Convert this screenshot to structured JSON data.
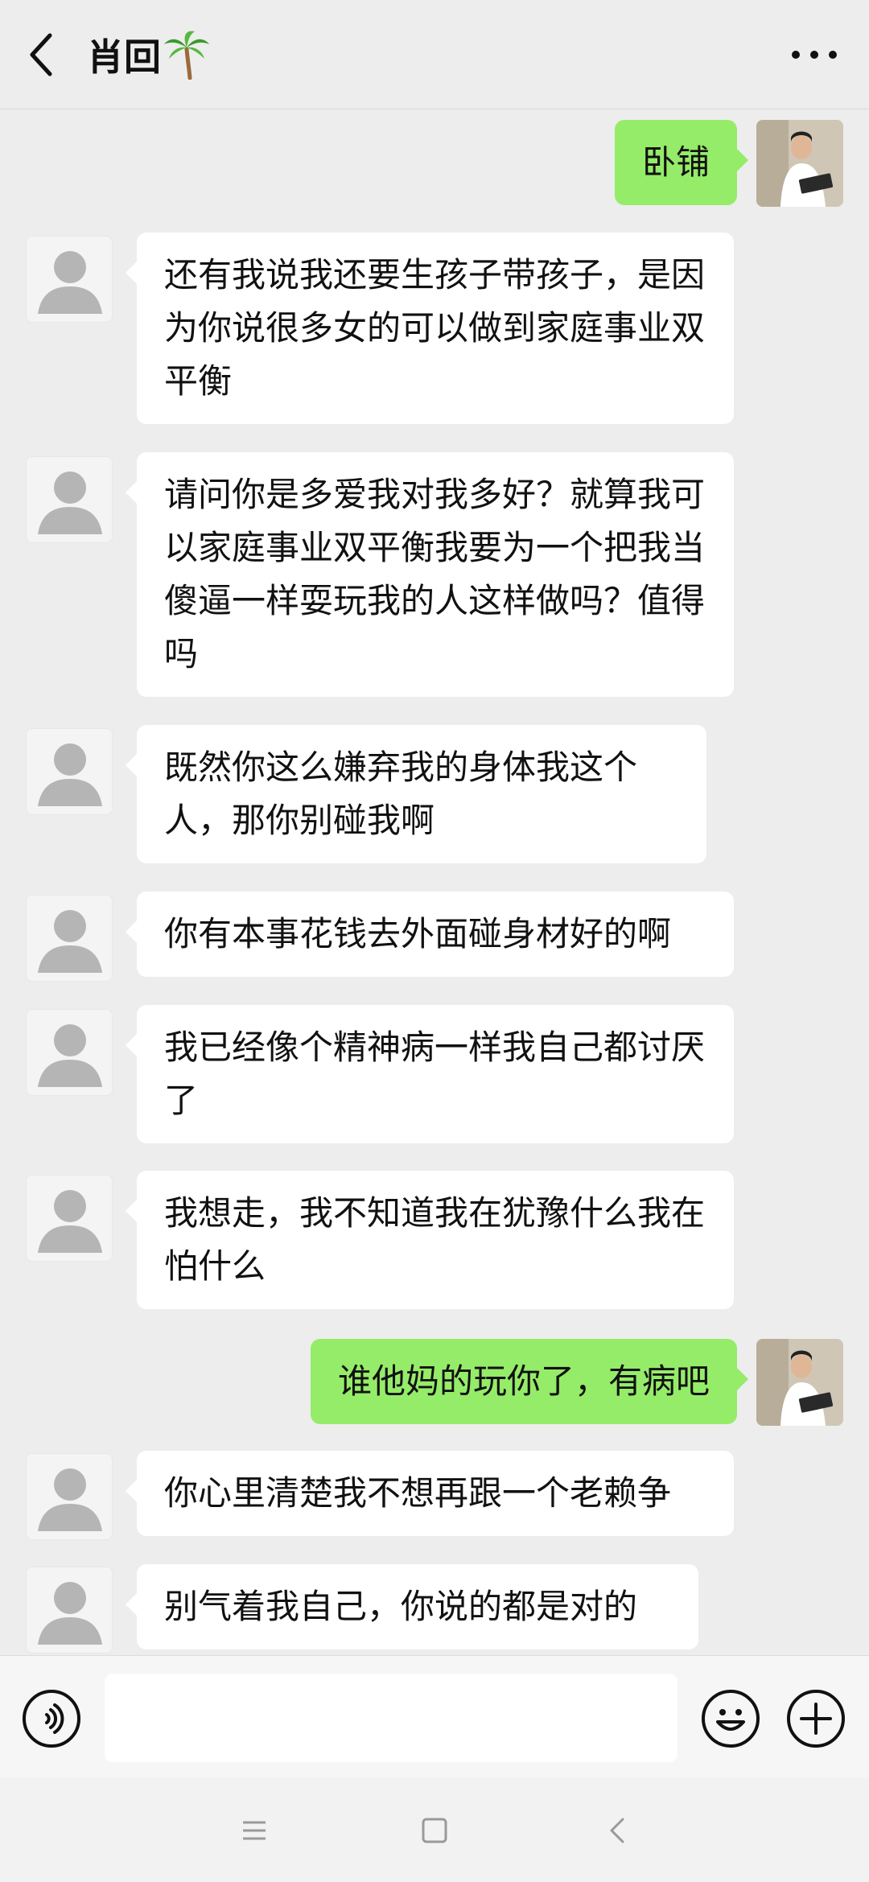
{
  "header": {
    "back_icon": "chevron-left-icon",
    "contact_name": "肖回",
    "name_emoji_icon": "palm-tree-icon",
    "more_icon": "more-dots-icon"
  },
  "messages": [
    {
      "side": "right",
      "text": "卧铺"
    },
    {
      "side": "left",
      "text": "还有我说我还要生孩子带孩子，是因为你说很多女的可以做到家庭事业双平衡"
    },
    {
      "side": "left",
      "text": "请问你是多爱我对我多好？就算我可以家庭事业双平衡我要为一个把我当傻逼一样耍玩我的人这样做吗？值得吗"
    },
    {
      "side": "left",
      "text": "既然你这么嫌弃我的身体我这个人，那你别碰我啊"
    },
    {
      "side": "left",
      "text": "你有本事花钱去外面碰身材好的啊"
    },
    {
      "side": "left",
      "text": "我已经像个精神病一样我自己都讨厌了"
    },
    {
      "side": "left",
      "text": "我想走，我不知道我在犹豫什么我在怕什么"
    },
    {
      "side": "right",
      "text": "谁他妈的玩你了，有病吧"
    },
    {
      "side": "left",
      "text": "你心里清楚我不想再跟一个老赖争"
    },
    {
      "side": "left",
      "text": "别气着我自己，你说的都是对的"
    }
  ],
  "input_bar": {
    "voice_icon": "voice-icon",
    "input_value": "",
    "emoji_icon": "emoji-icon",
    "plus_icon": "plus-icon"
  },
  "nav_bar": {
    "menu_icon": "menu-icon",
    "home_icon": "home-icon",
    "back_icon": "back-icon"
  },
  "colors": {
    "background": "#ededed",
    "bubble_self": "#95ec69",
    "bubble_other": "#ffffff"
  }
}
